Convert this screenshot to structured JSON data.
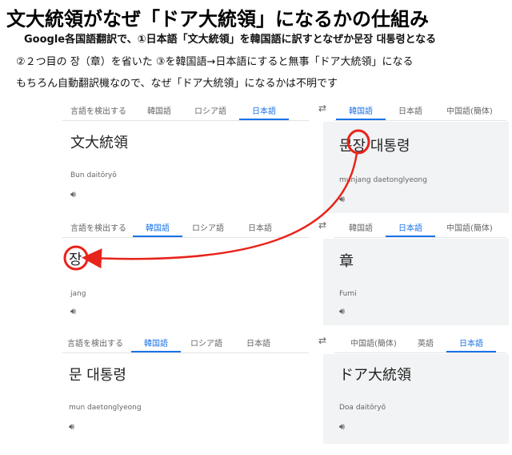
{
  "title": "文大統領がなぜ「ドア大統領」になるかの仕組み",
  "explanation": {
    "line1": "Google各国語翻訳で、①日本語「文大統領」を韓国語に訳すとなぜか문장 대통령となる",
    "line2": "②２つ目の 장（章）を省いた ③を韓国語→日本語にすると無事「ドア大統領」になる",
    "line3": "もちろん自動翻訳機なので、なぜ「ドア大統領」になるかは不明です"
  },
  "icons": {
    "swap": "swap-arrows-icon",
    "speaker": "speaker-icon"
  },
  "colors": {
    "accent": "#1a73e8",
    "highlight": "#e8231a",
    "pane_right": "#f1f3f4"
  },
  "panel1": {
    "src_tabs": [
      "言語を検出する",
      "韓国語",
      "ロシア語",
      "日本語"
    ],
    "src_active": 3,
    "tgt_tabs": [
      "韓国語",
      "日本語",
      "中国語(簡体)"
    ],
    "tgt_active": 0,
    "source_text": "文大統領",
    "source_romaji": "Bun daitōryō",
    "target_hl": "문장",
    "target_text": "대통령",
    "target_romaji": "munjang daetonglyeong"
  },
  "panel2": {
    "src_tabs": [
      "言語を検出する",
      "韓国語",
      "ロシア語",
      "日本語"
    ],
    "src_active": 1,
    "tgt_tabs": [
      "韓国語",
      "日本語",
      "中国語(簡体)"
    ],
    "tgt_active": 1,
    "source_text": "장",
    "source_romaji": "jang",
    "target_text": "章",
    "target_romaji": "Fumi"
  },
  "panel3": {
    "src_tabs": [
      "言語を検出する",
      "韓国語",
      "ロシア語",
      "日本語"
    ],
    "src_active": 1,
    "tgt_tabs": [
      "中国語(簡体)",
      "英語",
      "日本語"
    ],
    "tgt_active": 2,
    "source_text": "문 대통령",
    "source_romaji": "mun daetonglyeong",
    "target_text": "ドア大統領",
    "target_romaji": "Doa daitōryō"
  }
}
